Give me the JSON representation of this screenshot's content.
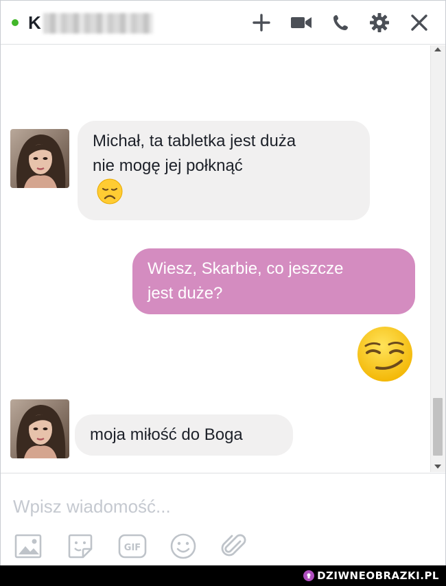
{
  "header": {
    "contact_initial": "K",
    "status": "online",
    "icons": [
      "plus-icon",
      "video-camera-icon",
      "phone-icon",
      "gear-icon",
      "close-icon"
    ]
  },
  "messages": [
    {
      "direction": "incoming",
      "lines": [
        "Michał, ta tabletka jest duża",
        "nie mogę jej połknąć"
      ],
      "emoji": "disappointed-face"
    },
    {
      "direction": "outgoing",
      "lines": [
        "Wiesz, Skarbie, co jeszcze",
        "jest duże?"
      ]
    },
    {
      "direction": "outgoing",
      "emoji": "smirking-face"
    },
    {
      "direction": "incoming",
      "lines": [
        "moja miłość do Boga"
      ]
    }
  ],
  "composer": {
    "placeholder": "Wpisz wiadomość...",
    "value": "",
    "tools": [
      "photo-icon",
      "sticker-icon",
      "gif-icon",
      "emoji-icon",
      "attachment-icon"
    ]
  },
  "watermark": {
    "text": "DZIWNEOBRAZKI.PL"
  },
  "colors": {
    "outgoing_bubble": "#d48cc0",
    "incoming_bubble": "#f1f0f0",
    "online": "#42b72a"
  }
}
